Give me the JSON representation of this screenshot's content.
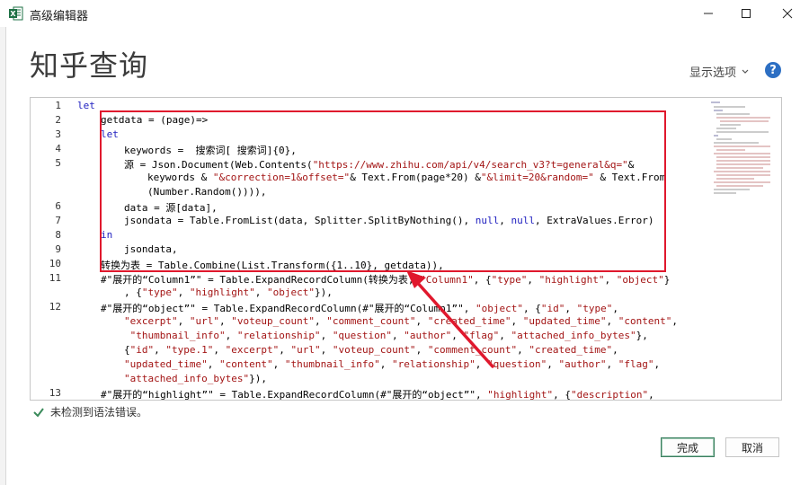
{
  "window": {
    "title": "高级编辑器",
    "icon": "excel-icon"
  },
  "header": {
    "query_name": "知乎查询",
    "display_options_label": "显示选项",
    "help_label": "?"
  },
  "editor": {
    "line_numbers": [
      "1",
      "2",
      "3",
      "4",
      "5",
      "6",
      "7",
      "8",
      "9",
      "10",
      "11",
      "12",
      "13"
    ],
    "lines": [
      {
        "n": "1",
        "indent": 0,
        "text": "let"
      },
      {
        "n": "2",
        "indent": 1,
        "text": "getdata = (page)=>"
      },
      {
        "n": "3",
        "indent": 1,
        "text": "let"
      },
      {
        "n": "4",
        "indent": 2,
        "text": "keywords =  搜索词[ 搜索词]{0},"
      },
      {
        "n": "5",
        "indent": 2,
        "text": "源 = Json.Document(Web.Contents(\"https://www.zhihu.com/api/v4/search_v3?t=general&q=\"&"
      },
      {
        "n": "",
        "indent": 3,
        "text": "keywords & \"&correction=1&offset=\"& Text.From(page*20) &\"&limit=20&random=\" & Text.From"
      },
      {
        "n": "",
        "indent": 3,
        "text": "(Number.Random()))),"
      },
      {
        "n": "6",
        "indent": 2,
        "text": "data = 源[data],"
      },
      {
        "n": "7",
        "indent": 2,
        "text": "jsondata = Table.FromList(data, Splitter.SplitByNothing(), null, null, ExtraValues.Error)"
      },
      {
        "n": "8",
        "indent": 1,
        "text": "in"
      },
      {
        "n": "9",
        "indent": 2,
        "text": "jsondata,"
      },
      {
        "n": "10",
        "indent": 1,
        "text": "转换为表 = Table.Combine(List.Transform({1..10}, getdata)),"
      },
      {
        "n": "11",
        "indent": 1,
        "text": "#\"展开的“Column1”\" = Table.ExpandRecordColumn(转换为表, \"Column1\", {\"type\", \"highlight\", \"object\"}"
      },
      {
        "n": "",
        "indent": 2,
        "text": ", {\"type\", \"highlight\", \"object\"}),"
      },
      {
        "n": "12",
        "indent": 1,
        "text": "#\"展开的“object”\" = Table.ExpandRecordColumn(#\"展开的“Column1”\", \"object\", {\"id\", \"type\","
      },
      {
        "n": "",
        "indent": 2,
        "text": "\"excerpt\", \"url\", \"voteup_count\", \"comment_count\", \"created_time\", \"updated_time\", \"content\","
      },
      {
        "n": "",
        "indent": 2,
        "text": " \"thumbnail_info\", \"relationship\", \"question\", \"author\", \"flag\", \"attached_info_bytes\"},"
      },
      {
        "n": "",
        "indent": 2,
        "text": "{\"id\", \"type.1\", \"excerpt\", \"url\", \"voteup_count\", \"comment_count\", \"created_time\","
      },
      {
        "n": "",
        "indent": 2,
        "text": "\"updated_time\", \"content\", \"thumbnail_info\", \"relationship\", \"question\", \"author\", \"flag\","
      },
      {
        "n": "",
        "indent": 2,
        "text": "\"attached_info_bytes\"}),"
      },
      {
        "n": "13",
        "indent": 1,
        "text": "#\"展开的“highlight”\" = Table.ExpandRecordColumn(#\"展开的“object”\", \"highlight\", {\"description\","
      }
    ]
  },
  "status": {
    "message": "未检测到语法错误。"
  },
  "buttons": {
    "done": "完成",
    "cancel": "取消"
  },
  "colors": {
    "accent": "#2d6fc3",
    "annotation": "#e0182d",
    "ok": "#3a8a5a"
  }
}
